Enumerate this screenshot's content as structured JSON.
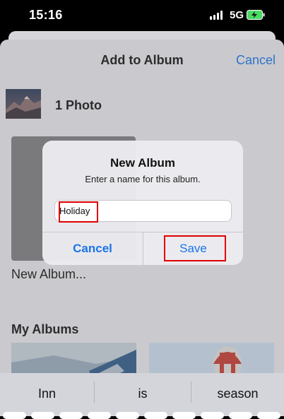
{
  "status_bar": {
    "time": "15:16",
    "network": "5G"
  },
  "sheet": {
    "title": "Add to Album",
    "cancel_label": "Cancel",
    "photo_count": "1 Photo",
    "new_album_label": "New Album...",
    "my_albums_title": "My Albums"
  },
  "dialog": {
    "title": "New Album",
    "message": "Enter a name for this album.",
    "field_value": "Holiday",
    "cancel_label": "Cancel",
    "save_label": "Save"
  },
  "keyboard": {
    "suggestions": [
      "Inn",
      "is",
      "season"
    ]
  },
  "colors": {
    "accent": "#1a73e8",
    "highlight": "#e00000",
    "battery": "#4cd964"
  },
  "icons": [
    "signal-icon",
    "battery-charging-icon"
  ]
}
